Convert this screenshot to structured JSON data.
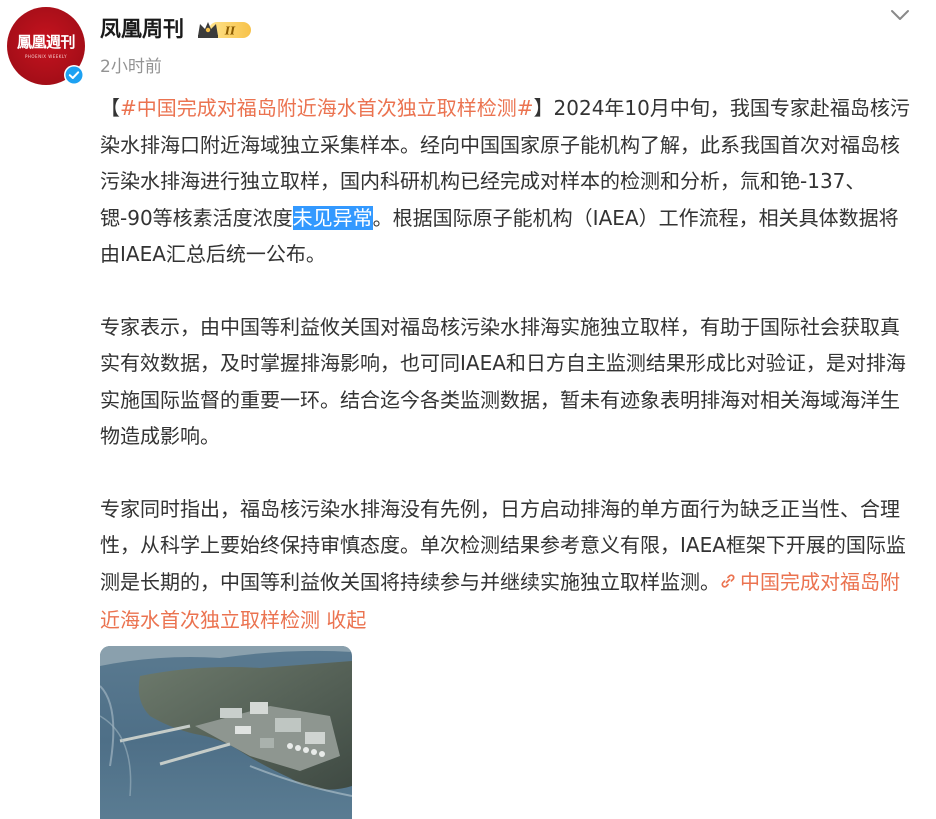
{
  "author": {
    "name": "凤凰周刊",
    "avatar_text": "鳳凰週刊",
    "avatar_subtext": "PHOENIX WEEKLY",
    "badge_text": "II",
    "verified_icon": "verified-check-icon",
    "verified_color": "#1da1f2"
  },
  "post": {
    "time": "2小时前",
    "more_icon": "chevron-down-icon",
    "paragraphs": [
      {
        "topic_tag": "#中国完成对福岛附近海水首次独立取样检测#",
        "bracket_open": "【",
        "bracket_close": "】",
        "text_before": "2024年10月中旬，我国专家赴福岛核污染水排海口附近海域独立采集样本。经向中国国家原子能机构了解，此系我国首次对福岛核污染水排海进行独立取样，国内科研机构已经完成对样本的检测和分析，氚和铯-137、锶-90等核素活度浓度",
        "highlight": "未见异常",
        "text_after": "。根据国际原子能机构（IAEA）工作流程，相关具体数据将由IAEA汇总后统一公布。"
      },
      {
        "text": "专家表示，由中国等利益攸关国对福岛核污染水排海实施独立取样，有助于国际社会获取真实有效数据，及时掌握排海影响，也可同IAEA和日方自主监测结果形成比对验证，是对排海实施国际监督的重要一环。结合迄今各类监测数据，暂未有迹象表明排海对相关海域海洋生物造成影响。"
      },
      {
        "text": "专家同时指出，福岛核污染水排海没有先例，日方启动排海的单方面行为缺乏正当性、合理性，从科学上要始终保持审慎态度。单次检测结果参考意义有限，IAEA框架下开展的国际监测是长期的，中国等利益攸关国将持续参与并继续实施独立取样监测。",
        "link_icon": "link-icon",
        "link_text": "中国完成对福岛附近海水首次独立取样检测",
        "collapse_text": "收起"
      }
    ]
  },
  "colors": {
    "link": "#eb7350",
    "highlight_bg": "#3399ff",
    "text": "#333333",
    "muted": "#939393",
    "avatar_red": "#c6131f"
  }
}
